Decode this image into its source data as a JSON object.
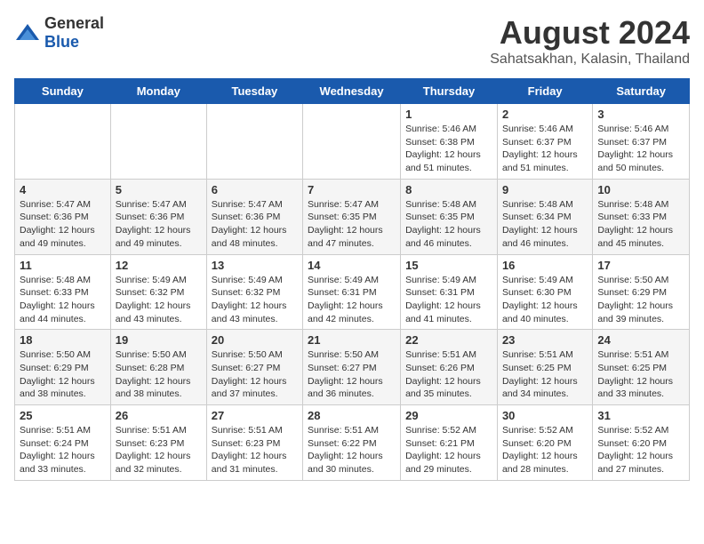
{
  "header": {
    "logo_general": "General",
    "logo_blue": "Blue",
    "title": "August 2024",
    "subtitle": "Sahatsakhan, Kalasin, Thailand"
  },
  "weekdays": [
    "Sunday",
    "Monday",
    "Tuesday",
    "Wednesday",
    "Thursday",
    "Friday",
    "Saturday"
  ],
  "weeks": [
    [
      {
        "day": "",
        "info": ""
      },
      {
        "day": "",
        "info": ""
      },
      {
        "day": "",
        "info": ""
      },
      {
        "day": "",
        "info": ""
      },
      {
        "day": "1",
        "info": "Sunrise: 5:46 AM\nSunset: 6:38 PM\nDaylight: 12 hours\nand 51 minutes."
      },
      {
        "day": "2",
        "info": "Sunrise: 5:46 AM\nSunset: 6:37 PM\nDaylight: 12 hours\nand 51 minutes."
      },
      {
        "day": "3",
        "info": "Sunrise: 5:46 AM\nSunset: 6:37 PM\nDaylight: 12 hours\nand 50 minutes."
      }
    ],
    [
      {
        "day": "4",
        "info": "Sunrise: 5:47 AM\nSunset: 6:36 PM\nDaylight: 12 hours\nand 49 minutes."
      },
      {
        "day": "5",
        "info": "Sunrise: 5:47 AM\nSunset: 6:36 PM\nDaylight: 12 hours\nand 49 minutes."
      },
      {
        "day": "6",
        "info": "Sunrise: 5:47 AM\nSunset: 6:36 PM\nDaylight: 12 hours\nand 48 minutes."
      },
      {
        "day": "7",
        "info": "Sunrise: 5:47 AM\nSunset: 6:35 PM\nDaylight: 12 hours\nand 47 minutes."
      },
      {
        "day": "8",
        "info": "Sunrise: 5:48 AM\nSunset: 6:35 PM\nDaylight: 12 hours\nand 46 minutes."
      },
      {
        "day": "9",
        "info": "Sunrise: 5:48 AM\nSunset: 6:34 PM\nDaylight: 12 hours\nand 46 minutes."
      },
      {
        "day": "10",
        "info": "Sunrise: 5:48 AM\nSunset: 6:33 PM\nDaylight: 12 hours\nand 45 minutes."
      }
    ],
    [
      {
        "day": "11",
        "info": "Sunrise: 5:48 AM\nSunset: 6:33 PM\nDaylight: 12 hours\nand 44 minutes."
      },
      {
        "day": "12",
        "info": "Sunrise: 5:49 AM\nSunset: 6:32 PM\nDaylight: 12 hours\nand 43 minutes."
      },
      {
        "day": "13",
        "info": "Sunrise: 5:49 AM\nSunset: 6:32 PM\nDaylight: 12 hours\nand 43 minutes."
      },
      {
        "day": "14",
        "info": "Sunrise: 5:49 AM\nSunset: 6:31 PM\nDaylight: 12 hours\nand 42 minutes."
      },
      {
        "day": "15",
        "info": "Sunrise: 5:49 AM\nSunset: 6:31 PM\nDaylight: 12 hours\nand 41 minutes."
      },
      {
        "day": "16",
        "info": "Sunrise: 5:49 AM\nSunset: 6:30 PM\nDaylight: 12 hours\nand 40 minutes."
      },
      {
        "day": "17",
        "info": "Sunrise: 5:50 AM\nSunset: 6:29 PM\nDaylight: 12 hours\nand 39 minutes."
      }
    ],
    [
      {
        "day": "18",
        "info": "Sunrise: 5:50 AM\nSunset: 6:29 PM\nDaylight: 12 hours\nand 38 minutes."
      },
      {
        "day": "19",
        "info": "Sunrise: 5:50 AM\nSunset: 6:28 PM\nDaylight: 12 hours\nand 38 minutes."
      },
      {
        "day": "20",
        "info": "Sunrise: 5:50 AM\nSunset: 6:27 PM\nDaylight: 12 hours\nand 37 minutes."
      },
      {
        "day": "21",
        "info": "Sunrise: 5:50 AM\nSunset: 6:27 PM\nDaylight: 12 hours\nand 36 minutes."
      },
      {
        "day": "22",
        "info": "Sunrise: 5:51 AM\nSunset: 6:26 PM\nDaylight: 12 hours\nand 35 minutes."
      },
      {
        "day": "23",
        "info": "Sunrise: 5:51 AM\nSunset: 6:25 PM\nDaylight: 12 hours\nand 34 minutes."
      },
      {
        "day": "24",
        "info": "Sunrise: 5:51 AM\nSunset: 6:25 PM\nDaylight: 12 hours\nand 33 minutes."
      }
    ],
    [
      {
        "day": "25",
        "info": "Sunrise: 5:51 AM\nSunset: 6:24 PM\nDaylight: 12 hours\nand 33 minutes."
      },
      {
        "day": "26",
        "info": "Sunrise: 5:51 AM\nSunset: 6:23 PM\nDaylight: 12 hours\nand 32 minutes."
      },
      {
        "day": "27",
        "info": "Sunrise: 5:51 AM\nSunset: 6:23 PM\nDaylight: 12 hours\nand 31 minutes."
      },
      {
        "day": "28",
        "info": "Sunrise: 5:51 AM\nSunset: 6:22 PM\nDaylight: 12 hours\nand 30 minutes."
      },
      {
        "day": "29",
        "info": "Sunrise: 5:52 AM\nSunset: 6:21 PM\nDaylight: 12 hours\nand 29 minutes."
      },
      {
        "day": "30",
        "info": "Sunrise: 5:52 AM\nSunset: 6:20 PM\nDaylight: 12 hours\nand 28 minutes."
      },
      {
        "day": "31",
        "info": "Sunrise: 5:52 AM\nSunset: 6:20 PM\nDaylight: 12 hours\nand 27 minutes."
      }
    ]
  ]
}
